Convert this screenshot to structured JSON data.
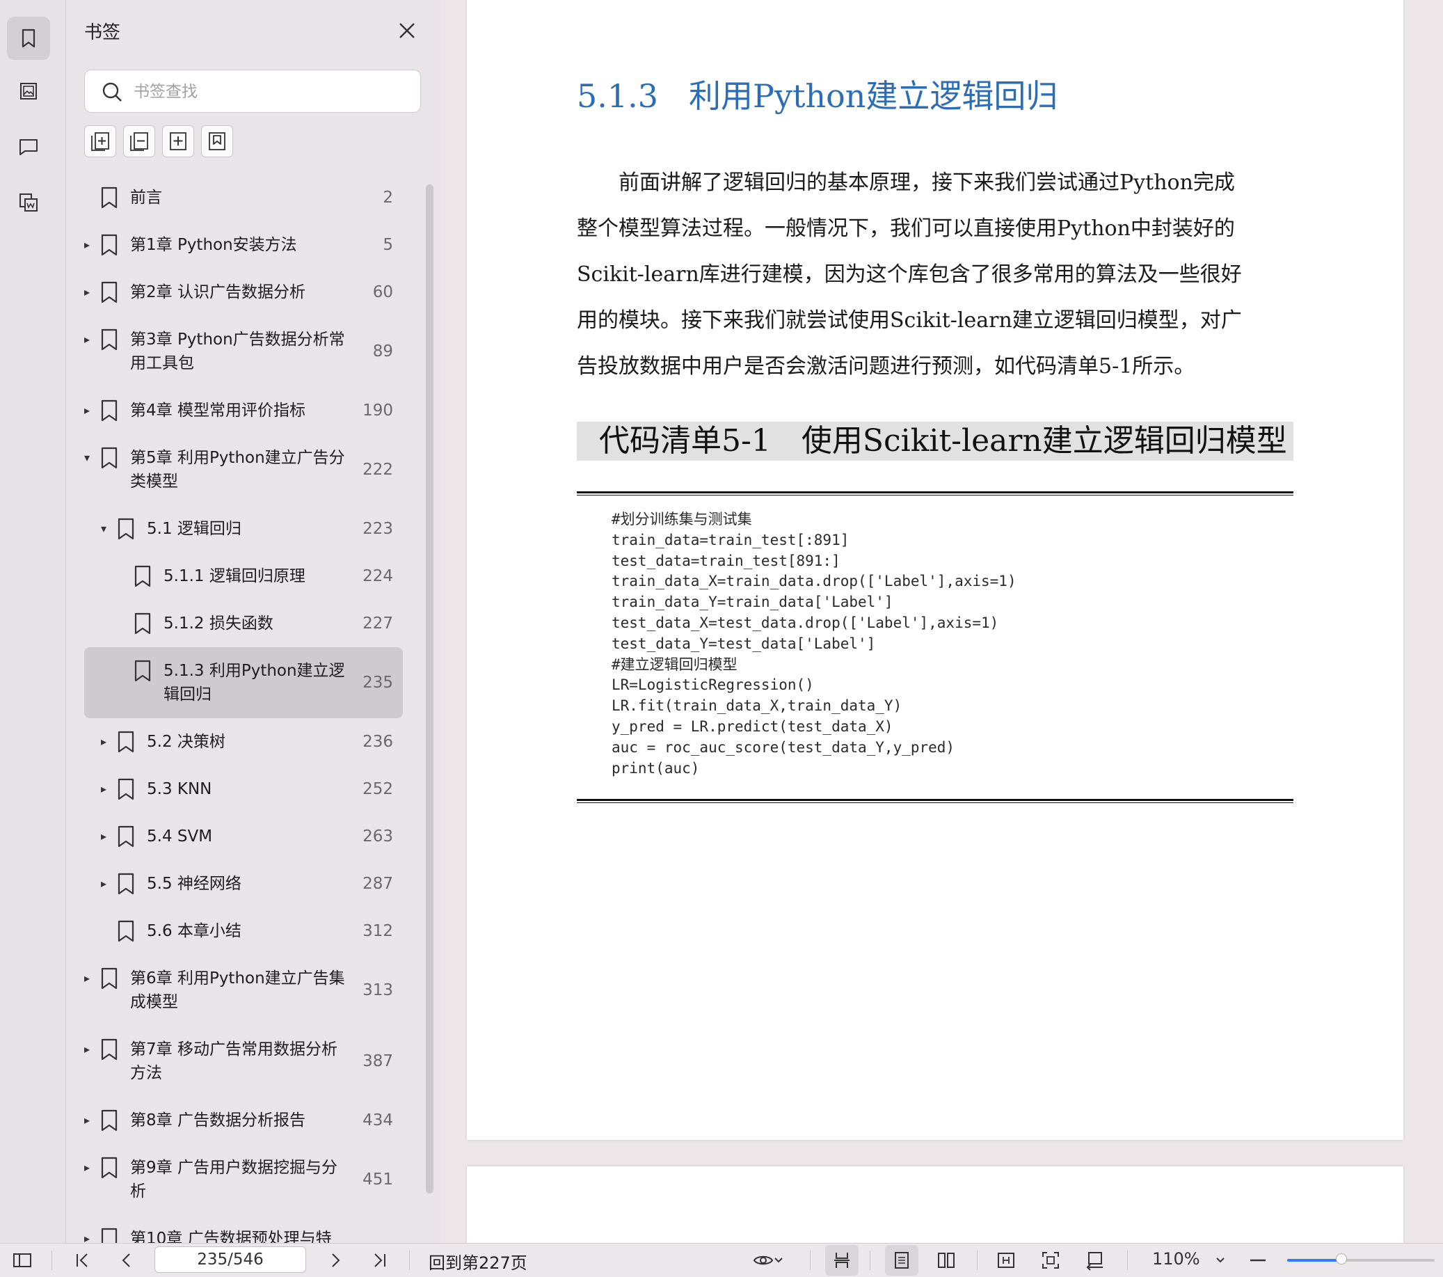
{
  "panel": {
    "title": "书签",
    "search_placeholder": "书签查找",
    "tools": [
      "expand-all-icon",
      "collapse-all-icon",
      "add-bookmark-icon",
      "bookmark-icon"
    ]
  },
  "bookmarks": [
    {
      "label": "前言",
      "page": "2",
      "level": 0,
      "arrow": "",
      "lines": 1
    },
    {
      "label": "第1章 Python安装方法",
      "page": "5",
      "level": 0,
      "arrow": "▸",
      "lines": 1
    },
    {
      "label": "第2章 认识广告数据分析",
      "page": "60",
      "level": 0,
      "arrow": "▸",
      "lines": 1
    },
    {
      "label": "第3章 Python广告数据分析常用工具包",
      "label_lines": [
        "第3章 Python广告数据分析常",
        "用工具包"
      ],
      "page": "89",
      "level": 0,
      "arrow": "▸",
      "lines": 2
    },
    {
      "label": "第4章 模型常用评价指标",
      "page": "190",
      "level": 0,
      "arrow": "▸",
      "lines": 1
    },
    {
      "label": "第5章 利用Python建立广告分类模型",
      "label_lines": [
        "第5章 利用Python建立广告分",
        "类模型"
      ],
      "page": "222",
      "level": 0,
      "arrow": "▾",
      "lines": 2
    },
    {
      "label": "5.1 逻辑回归",
      "page": "223",
      "level": 1,
      "arrow": "▾",
      "lines": 1
    },
    {
      "label": "5.1.1 逻辑回归原理",
      "page": "224",
      "level": 2,
      "arrow": "",
      "lines": 1
    },
    {
      "label": "5.1.2 损失函数",
      "page": "227",
      "level": 2,
      "arrow": "",
      "lines": 1
    },
    {
      "label": "5.1.3 利用Python建立逻辑回归",
      "label_lines": [
        "5.1.3 利用Python建立逻",
        "辑回归"
      ],
      "page": "235",
      "level": 2,
      "arrow": "",
      "lines": 2,
      "selected": true
    },
    {
      "label": "5.2 决策树",
      "page": "236",
      "level": 1,
      "arrow": "▸",
      "lines": 1
    },
    {
      "label": "5.3 KNN",
      "page": "252",
      "level": 1,
      "arrow": "▸",
      "lines": 1
    },
    {
      "label": "5.4 SVM",
      "page": "263",
      "level": 1,
      "arrow": "▸",
      "lines": 1
    },
    {
      "label": "5.5 神经网络",
      "page": "287",
      "level": 1,
      "arrow": "▸",
      "lines": 1
    },
    {
      "label": "5.6 本章小结",
      "page": "312",
      "level": 1,
      "arrow": "",
      "lines": 1
    },
    {
      "label": "第6章 利用Python建立广告集成模型",
      "label_lines": [
        "第6章 利用Python建立广告集",
        "成模型"
      ],
      "page": "313",
      "level": 0,
      "arrow": "▸",
      "lines": 2
    },
    {
      "label": "第7章 移动广告常用数据分析方法",
      "label_lines": [
        "第7章 移动广告常用数据分析",
        "方法"
      ],
      "page": "387",
      "level": 0,
      "arrow": "▸",
      "lines": 2
    },
    {
      "label": "第8章 广告数据分析报告",
      "page": "434",
      "level": 0,
      "arrow": "▸",
      "lines": 1
    },
    {
      "label": "第9章 广告用户数据挖掘与分析",
      "label_lines": [
        "第9章 广告用户数据挖掘与分",
        "析"
      ],
      "page": "451",
      "level": 0,
      "arrow": "▸",
      "lines": 2
    },
    {
      "label": "第10章 广告数据预处理与特",
      "page": "",
      "level": 0,
      "arrow": "▸",
      "lines": 1
    }
  ],
  "document": {
    "section_number": "5.1.3",
    "section_title": "利用Python建立逻辑回归",
    "paragraph_lines": [
      "　　前面讲解了逻辑回归的基本原理，接下来我们尝试通过Python完成",
      "整个模型算法过程。一般情况下，我们可以直接使用Python中封装好的",
      "Scikit-learn库进行建模，因为这个库包含了很多常用的算法及一些很好",
      "用的模块。接下来我们就尝试使用Scikit-learn建立逻辑回归模型，对广",
      "告投放数据中用户是否会激活问题进行预测，如代码清单5-1所示。"
    ],
    "code_caption": "代码清单5-1　使用Scikit-learn建立逻辑回归模型",
    "code_lines": [
      "#划分训练集与测试集",
      "train_data=train_test[:891]",
      "test_data=train_test[891:]",
      "train_data_X=train_data.drop(['Label'],axis=1)",
      "train_data_Y=train_data['Label']",
      "test_data_X=test_data.drop(['Label'],axis=1)",
      "test_data_Y=test_data['Label']",
      "#建立逻辑回归模型",
      "LR=LogisticRegression()",
      "LR.fit(train_data_X,train_data_Y)",
      "y_pred = LR.predict(test_data_X)",
      "auc = roc_auc_score(test_data_Y,y_pred)",
      "print(auc)"
    ]
  },
  "statusbar": {
    "page_value": "235/546",
    "back_to_label": "回到第227页",
    "zoom_label": "110%",
    "zoom_fraction": 0.37
  },
  "colors": {
    "heading": "#2d6db3",
    "zoom_accent": "#2f7cf6",
    "selection": "#cfcacf"
  }
}
